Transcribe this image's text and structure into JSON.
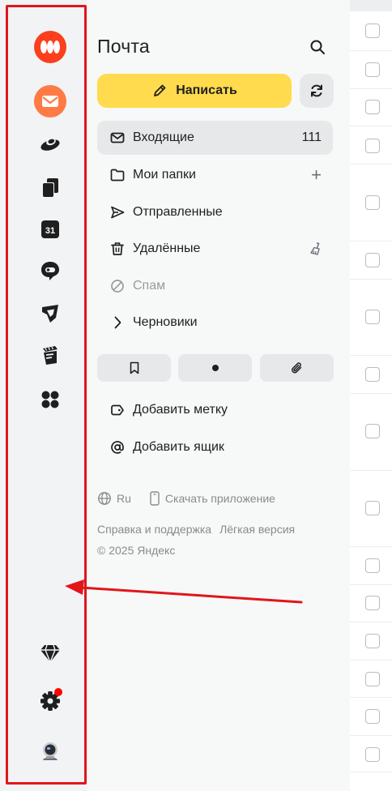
{
  "rail": {
    "apps": [
      {
        "name": "yandex-apps-logo-icon",
        "color": "#fc3f1d"
      },
      {
        "name": "mail-app-icon",
        "color": "#ff7a45"
      },
      {
        "name": "disk-app-icon"
      },
      {
        "name": "docs-app-icon"
      },
      {
        "name": "calendar-app-icon",
        "label": "31"
      },
      {
        "name": "messenger-app-icon"
      },
      {
        "name": "telemost-app-icon"
      },
      {
        "name": "notes-app-icon"
      },
      {
        "name": "all-services-icon"
      }
    ],
    "bottom": [
      {
        "name": "premium-diamond-icon"
      },
      {
        "name": "settings-gear-icon",
        "badge_color": "#ff0000"
      },
      {
        "name": "user-avatar-icon"
      }
    ]
  },
  "menu": {
    "title": "Почта",
    "compose_label": "Написать",
    "folders": [
      {
        "label": "Входящие",
        "count": "111",
        "active": true
      },
      {
        "label": "Мои папки",
        "action": "+"
      },
      {
        "label": "Отправленные"
      },
      {
        "label": "Удалённые"
      },
      {
        "label": "Спам",
        "muted": true
      },
      {
        "label": "Черновики"
      }
    ],
    "quick_filters": [
      "bookmark-icon",
      "unread-dot-icon",
      "attachment-icon"
    ],
    "add_label": "Добавить метку",
    "add_mailbox": "Добавить ящик",
    "footer": {
      "language": "Ru",
      "download_app": "Скачать приложение",
      "help": "Справка и поддержка",
      "lite": "Лёгкая версия",
      "copyright": "© 2025 Яндекс"
    }
  },
  "colors": {
    "accent_yellow": "#ffdb4d",
    "annotation_red": "#e0161b"
  }
}
